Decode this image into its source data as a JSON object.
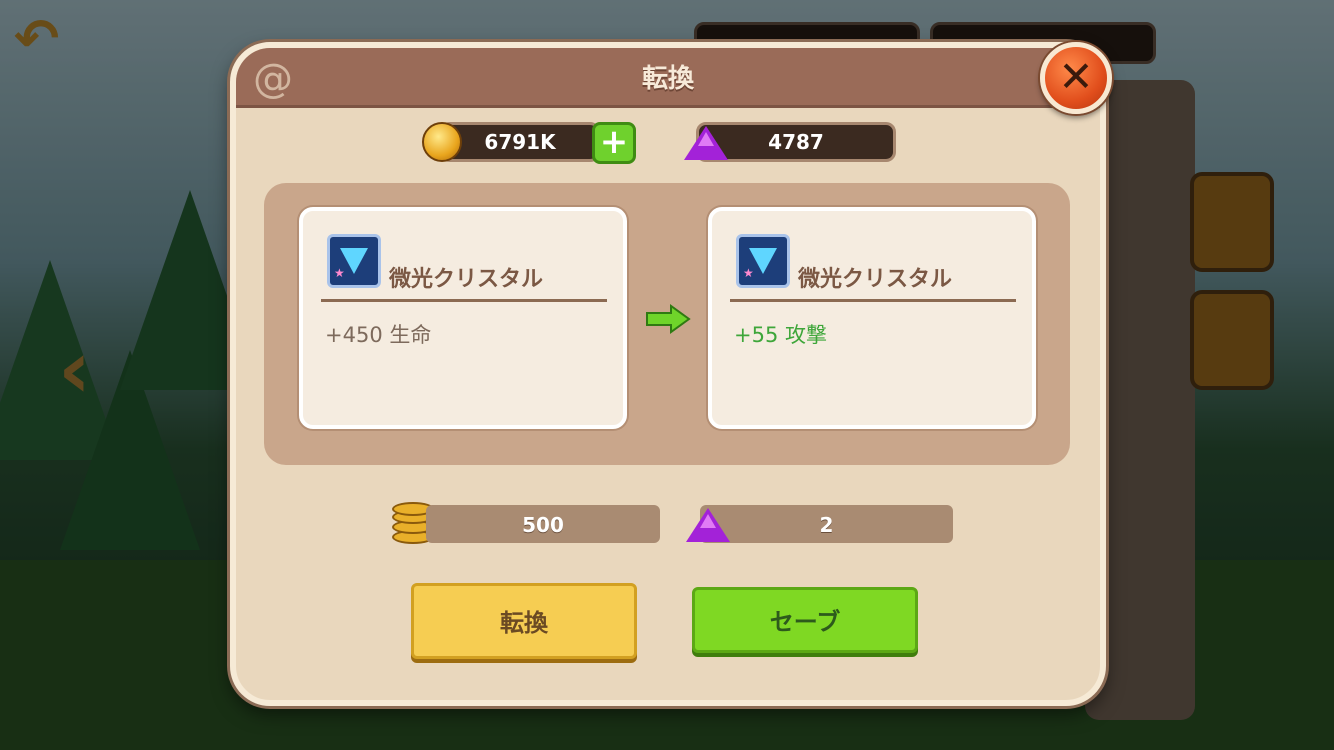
{
  "dialog": {
    "title": "転換",
    "close_icon": "close-x-icon"
  },
  "currency": {
    "gold": "6791K",
    "gems": "4787",
    "gold_icon": "gold-coin-icon",
    "gem_icon": "purple-gem-icon",
    "add_icon": "plus-icon"
  },
  "current_item": {
    "name": "微光クリスタル",
    "stat": "+450 生命",
    "icon": "blue-crystal-icon"
  },
  "new_item": {
    "name": "微光クリスタル",
    "stat": "+55 攻撃",
    "icon": "blue-crystal-icon"
  },
  "arrow_icon": "green-right-arrow-icon",
  "cost": {
    "gold": "500",
    "gems": "2",
    "gold_icon": "gold-coins-stack-icon",
    "gem_icon": "purple-gem-icon"
  },
  "buttons": {
    "convert": "転換",
    "save": "セーブ"
  },
  "colors": {
    "header": "#9a6b58",
    "dialog_bg": "#e9d7bd",
    "convert_button": "#f6cd52",
    "save_button": "#7fd823",
    "new_stat": "#3ea63a",
    "close_button": "#e14e1c"
  }
}
